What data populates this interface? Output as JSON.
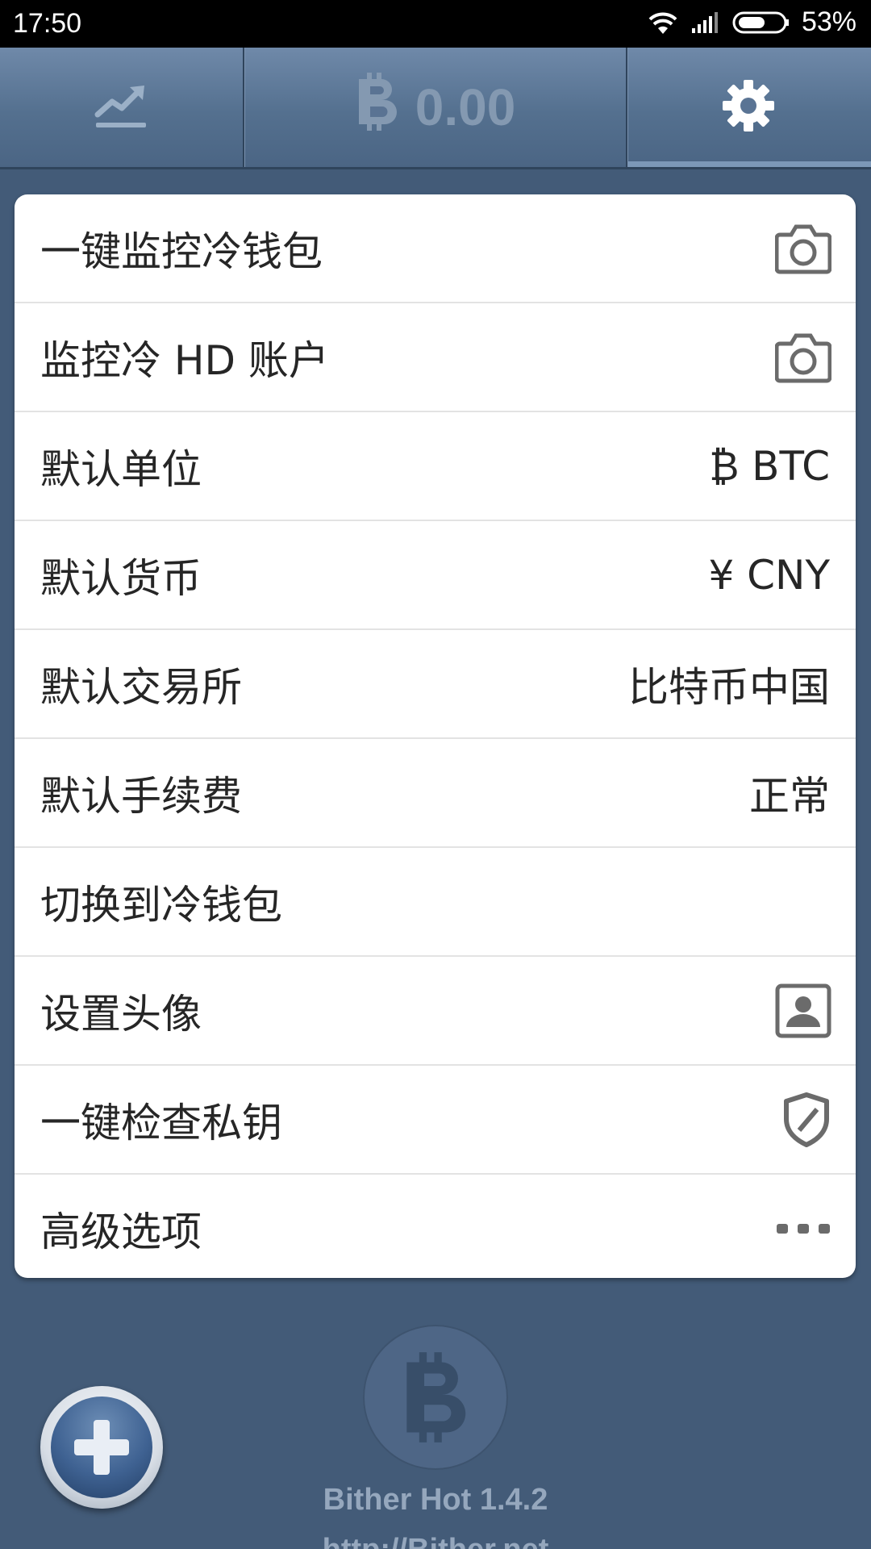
{
  "status_bar": {
    "time": "17:50",
    "battery_percent": "53%",
    "icons": [
      "wifi-icon",
      "signal-icon",
      "battery-icon"
    ]
  },
  "tabs": {
    "market_icon": "chart-trend-icon",
    "balance_icon": "bitcoin-icon",
    "balance": "0.00",
    "settings_icon": "gear-icon",
    "active": "settings"
  },
  "settings": {
    "items": [
      {
        "label": "一键监控冷钱包",
        "icon": "camera-icon"
      },
      {
        "label": "监控冷 HD 账户",
        "icon": "camera-icon"
      },
      {
        "label": "默认单位",
        "value": "₿ BTC"
      },
      {
        "label": "默认货币",
        "value": "¥ CNY"
      },
      {
        "label": "默认交易所",
        "value": "比特币中国"
      },
      {
        "label": "默认手续费",
        "value": "正常"
      },
      {
        "label": "切换到冷钱包"
      },
      {
        "label": "设置头像",
        "icon": "avatar-icon"
      },
      {
        "label": "一键检查私钥",
        "icon": "shield-icon"
      },
      {
        "label": "高级选项",
        "icon": "more-dots-icon"
      }
    ]
  },
  "footer": {
    "logo_icon": "bitcoin-logo-icon",
    "app_version": "Bither Hot  1.4.2",
    "app_url": "http://Bither.net",
    "add_button_icon": "plus-icon"
  },
  "colors": {
    "background": "#435b78",
    "tabbar": "#54708f",
    "card": "#ffffff",
    "text": "#262626"
  }
}
